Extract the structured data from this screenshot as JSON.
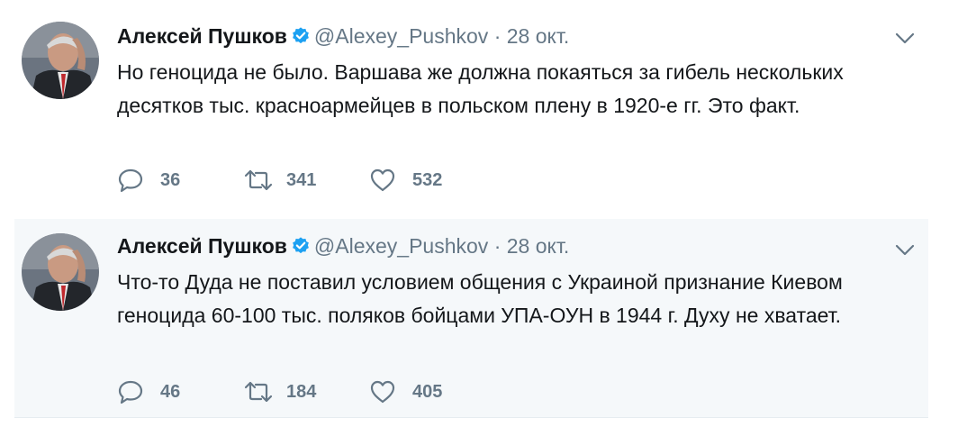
{
  "colors": {
    "text": "#14171a",
    "secondary": "#657786",
    "verified": "#1da1f2",
    "highlight_bg": "#f5f8fa"
  },
  "tweets": [
    {
      "fullname": "Алексей Пушков",
      "username": "@Alexey_Pushkov",
      "separator": "·",
      "time": "28 окт.",
      "text": "Но геноцида не было. Варшава же должна покаяться за гибель нескольких десятков тыс. красноармейцев в польском плену в 1920-е гг. Это факт.",
      "replies": "36",
      "retweets": "341",
      "likes": "532"
    },
    {
      "fullname": "Алексей Пушков",
      "username": "@Alexey_Pushkov",
      "separator": "·",
      "time": "28 окт.",
      "text": "Что-то Дуда не поставил условием общения с Украиной признание Киевом геноцида 60-100 тыс. поляков бойцами УПА-ОУН в 1944 г. Духу не хватает.",
      "replies": "46",
      "retweets": "184",
      "likes": "405"
    }
  ],
  "icons": {
    "verified": "verified-badge-icon",
    "caret": "chevron-down-icon",
    "reply": "reply-bubble-icon",
    "retweet": "retweet-arrows-icon",
    "like": "heart-icon"
  }
}
